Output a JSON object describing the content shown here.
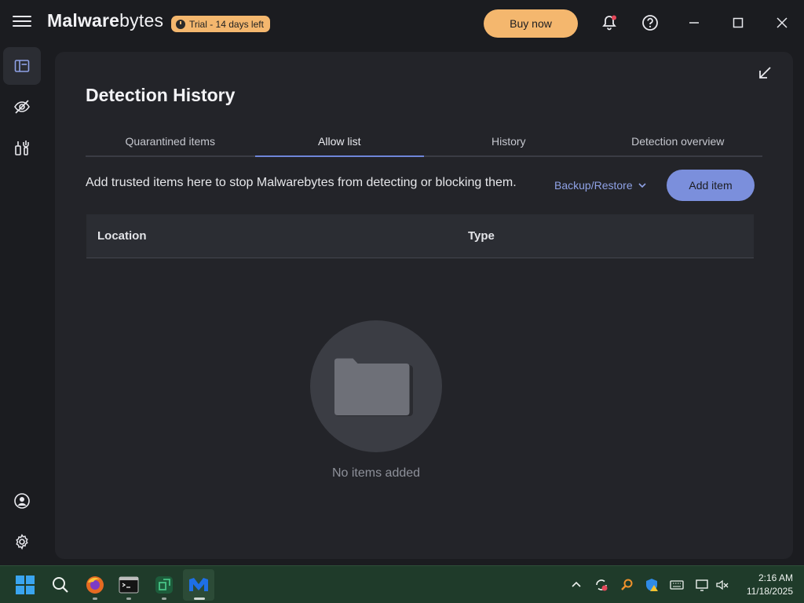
{
  "app": {
    "brand_bold": "Malware",
    "brand_light": "bytes",
    "trial_badge": "Trial - 14 days left",
    "buy_now": "Buy now"
  },
  "page": {
    "title": "Detection History",
    "tabs": [
      {
        "label": "Quarantined items",
        "active": false
      },
      {
        "label": "Allow list",
        "active": true
      },
      {
        "label": "History",
        "active": false
      },
      {
        "label": "Detection overview",
        "active": false
      }
    ],
    "description": "Add trusted items here to stop Malwarebytes from detecting or blocking them.",
    "backup_restore": "Backup/Restore",
    "add_item": "Add item",
    "table_headers": {
      "location": "Location",
      "type": "Type"
    },
    "empty_text": "No items added"
  },
  "taskbar": {
    "time": "2:16 AM",
    "date": "11/18/2025"
  },
  "colors": {
    "accent_orange": "#f4b76e",
    "accent_blue": "#7b8fdc",
    "link_blue": "#8fa2e6",
    "panel_bg": "#232429"
  }
}
